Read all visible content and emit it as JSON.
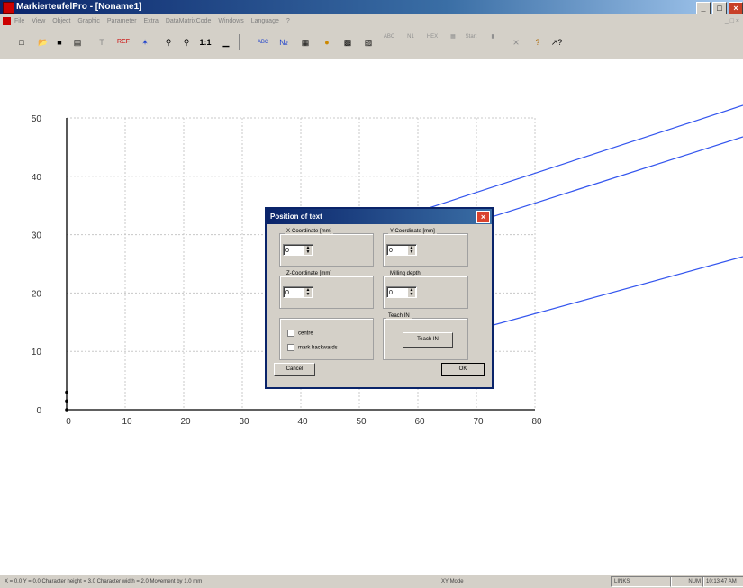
{
  "app": {
    "title": "MarkierteufelPro - [Noname1]"
  },
  "window_controls": {
    "minimize": "_",
    "maximize": "□",
    "close": "×"
  },
  "menu": {
    "items": [
      "File",
      "View",
      "Object",
      "Graphic",
      "Parameter",
      "Extra",
      "DataMatrixCode",
      "Windows",
      "Language",
      "?"
    ]
  },
  "toolbar": {
    "buttons": [
      "new-icon",
      "open-icon",
      "save-icon",
      "import-icon",
      "text-icon",
      "ref-icon",
      "scan-icon",
      "zoom-in-icon",
      "zoom-out-icon",
      "zoom-1to1-icon",
      "ruler-icon",
      "abc-icon",
      "counter-icon",
      "table-icon",
      "color-icon",
      "bitmap-icon",
      "barcode-icon",
      "abc-small-icon",
      "n1-icon",
      "hex-icon",
      "matrix-icon",
      "start-icon",
      "stop-icon",
      "delete-icon",
      "help-icon",
      "whatsthis-icon"
    ],
    "labels": {
      "oneone": "1:1",
      "abc": "ABC",
      "start": "Start"
    }
  },
  "chart_data": {
    "type": "scatter",
    "x_ticks": [
      "0",
      "10",
      "20",
      "30",
      "40",
      "50",
      "60",
      "70",
      "80"
    ],
    "y_ticks": [
      "0",
      "10",
      "20",
      "30",
      "40",
      "50"
    ],
    "xlim": [
      0,
      80
    ],
    "ylim": [
      0,
      50
    ],
    "grid": true,
    "points": [
      {
        "x": 0,
        "y": 0
      },
      {
        "x": 0,
        "y": 1.5
      },
      {
        "x": 0,
        "y": 3
      }
    ]
  },
  "dialog": {
    "title": "Position of text",
    "x_group": "X-Coordinate [mm]",
    "x_value": "0",
    "y_group": "Y-Coordinate [mm]",
    "y_value": "0",
    "z_group": "Z-Coordinate [mm]",
    "z_value": "0",
    "milling_group": "Milling depth",
    "milling_value": "0",
    "centre_label": "centre",
    "backwards_label": "mark backwards",
    "teach_group": "Teach IN",
    "teach_button": "Teach IN",
    "cancel_button": "Cancel",
    "ok_button": "OK"
  },
  "status": {
    "coords": "X = 0.0  Y = 0.0  Character height = 3.0  Character width = 2.0  Movement by 1.0 mm",
    "mode": "XY Mode",
    "links": "LINKS",
    "num": "NUM",
    "time": "10:13:47 AM"
  }
}
